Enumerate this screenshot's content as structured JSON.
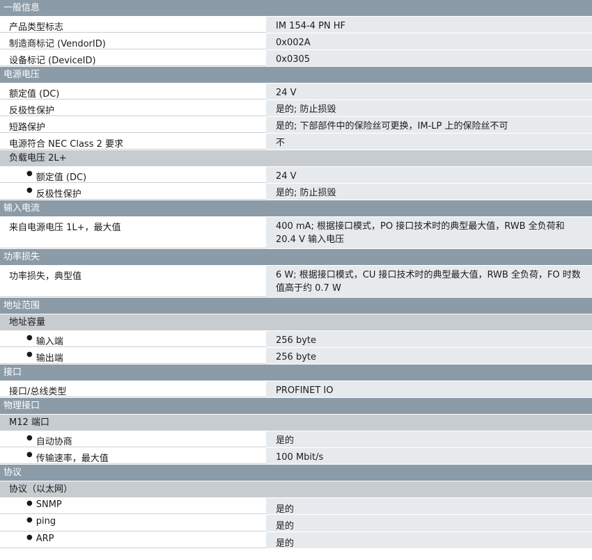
{
  "sections": {
    "general": "一般信息",
    "power_supply": "电源电压",
    "input_current": "输入电流",
    "power_loss": "功率损失",
    "address_area": "地址范围",
    "interface": "接口",
    "physical_interface": "物理接口",
    "protocol": "协议"
  },
  "subsections": {
    "load_voltage": "负载电压 2L+",
    "address_capacity": "地址容量",
    "m12_port": "M12 端口",
    "protocol_ethernet": "协议（以太网）"
  },
  "rows": {
    "product_type": {
      "label": "产品类型标志",
      "value": "IM 154-4 PN HF"
    },
    "vendor_id": {
      "label": "制造商标记 (VendorID)",
      "value": "0x002A"
    },
    "device_id": {
      "label": "设备标记 (DeviceID)",
      "value": "0x0305"
    },
    "rated_dc": {
      "label": "额定值 (DC)",
      "value": "24 V"
    },
    "reverse_polarity": {
      "label": "反极性保护",
      "value": "是的; 防止损毁"
    },
    "short_circuit": {
      "label": "短路保护",
      "value": "是的; 下部部件中的保险丝可更换，IM-LP 上的保险丝不可"
    },
    "nec_class2": {
      "label": "电源符合 NEC Class 2 要求",
      "value": "不"
    },
    "load_rated_dc": {
      "label": "额定值 (DC)",
      "value": "24 V"
    },
    "load_reverse": {
      "label": "反极性保护",
      "value": "是的; 防止损毁"
    },
    "from_supply": {
      "label": "来自电源电压 1L+，最大值",
      "value": "400 mA; 根据接口模式，PO 接口技术时的典型最大值，RWB 全负荷和 20.4 V 输入电压"
    },
    "power_loss_typ": {
      "label": "功率损失，典型值",
      "value": "6 W; 根据接口模式，CU 接口技术时的典型最大值，RWB 全负荷，FO 时数值高于约 0.7 W"
    },
    "inputs": {
      "label": "输入端",
      "value": "256 byte"
    },
    "outputs": {
      "label": "输出端",
      "value": "256 byte"
    },
    "bus_type": {
      "label": "接口/总线类型",
      "value": "PROFINET IO"
    },
    "autonegotiation": {
      "label": "自动协商",
      "value": "是的"
    },
    "transfer_rate": {
      "label": "传输速率，最大值",
      "value": "100 Mbit/s"
    },
    "snmp": {
      "label": "SNMP",
      "value": "是的"
    },
    "ping": {
      "label": "ping",
      "value": "是的"
    },
    "arp": {
      "label": "ARP",
      "value": "是的"
    }
  }
}
